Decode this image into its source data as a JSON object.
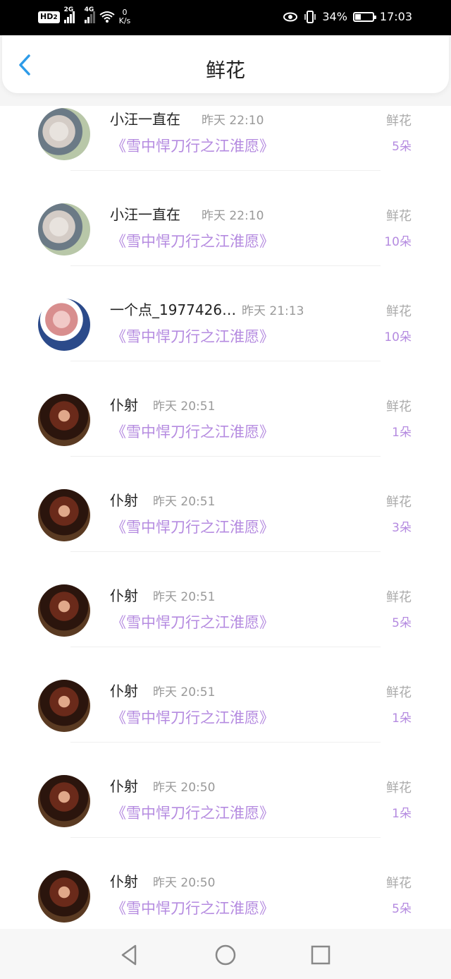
{
  "status_bar": {
    "hd": "HD",
    "hd_sub": "2",
    "net1": "2G",
    "net2": "4G",
    "speed_value": "0",
    "speed_unit": "K/s",
    "battery_percent": "34%",
    "battery_level": 0.34,
    "time": "17:03"
  },
  "header": {
    "title": "鲜花"
  },
  "list": [
    {
      "name": "小汪一直在",
      "time": "昨天 22:10",
      "book": "《雪中悍刀行之江淮愿》",
      "type": "鲜花",
      "count": "5朵",
      "avatar": "a1"
    },
    {
      "name": "小汪一直在",
      "time": "昨天 22:10",
      "book": "《雪中悍刀行之江淮愿》",
      "type": "鲜花",
      "count": "10朵",
      "avatar": "a1"
    },
    {
      "name": "一个点_1977426…",
      "time": "昨天 21:13",
      "book": "《雪中悍刀行之江淮愿》",
      "type": "鲜花",
      "count": "10朵",
      "avatar": "a2"
    },
    {
      "name": "仆射",
      "time": "昨天 20:51",
      "book": "《雪中悍刀行之江淮愿》",
      "type": "鲜花",
      "count": "1朵",
      "avatar": "a3"
    },
    {
      "name": "仆射",
      "time": "昨天 20:51",
      "book": "《雪中悍刀行之江淮愿》",
      "type": "鲜花",
      "count": "3朵",
      "avatar": "a3"
    },
    {
      "name": "仆射",
      "time": "昨天 20:51",
      "book": "《雪中悍刀行之江淮愿》",
      "type": "鲜花",
      "count": "5朵",
      "avatar": "a3"
    },
    {
      "name": "仆射",
      "time": "昨天 20:51",
      "book": "《雪中悍刀行之江淮愿》",
      "type": "鲜花",
      "count": "1朵",
      "avatar": "a3"
    },
    {
      "name": "仆射",
      "time": "昨天 20:50",
      "book": "《雪中悍刀行之江淮愿》",
      "type": "鲜花",
      "count": "1朵",
      "avatar": "a3"
    },
    {
      "name": "仆射",
      "time": "昨天 20:50",
      "book": "《雪中悍刀行之江淮愿》",
      "type": "鲜花",
      "count": "5朵",
      "avatar": "a3"
    }
  ],
  "nav": {
    "back_icon": "triangle-back-icon",
    "home_icon": "circle-home-icon",
    "recent_icon": "square-recent-icon"
  },
  "colors": {
    "accent": "#2d9be8",
    "book_purple": "#b58be0",
    "muted": "#999999"
  }
}
